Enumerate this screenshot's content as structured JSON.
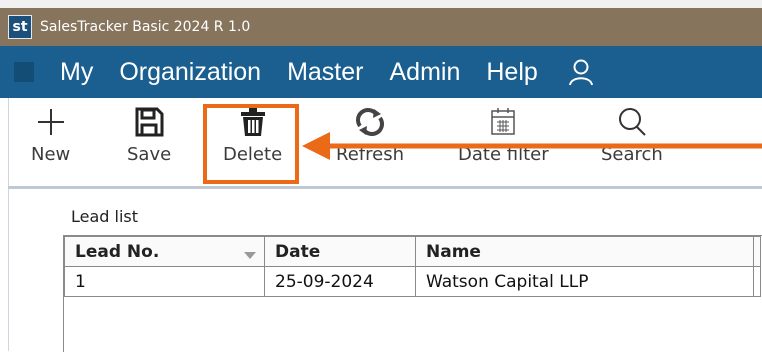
{
  "app": {
    "logo": "st",
    "title": "SalesTracker Basic 2024 R 1.0"
  },
  "menu": {
    "items": [
      "My",
      "Organization",
      "Master",
      "Admin",
      "Help"
    ],
    "user_icon": "user-icon"
  },
  "toolbar": {
    "new_label": "New",
    "save_label": "Save",
    "delete_label": "Delete",
    "refresh_label": "Refresh",
    "date_filter_label": "Date filter",
    "search_label": "Search"
  },
  "lead_list": {
    "label": "Lead list",
    "columns": [
      "Lead No.",
      "Date",
      "Name"
    ],
    "rows": [
      {
        "lead_no": "1",
        "date": "25-09-2024",
        "name": "Watson Capital LLP"
      }
    ]
  },
  "colors": {
    "titlebar": "#87745d",
    "menubar": "#1a5f8f",
    "highlight": "#ea6a17"
  }
}
